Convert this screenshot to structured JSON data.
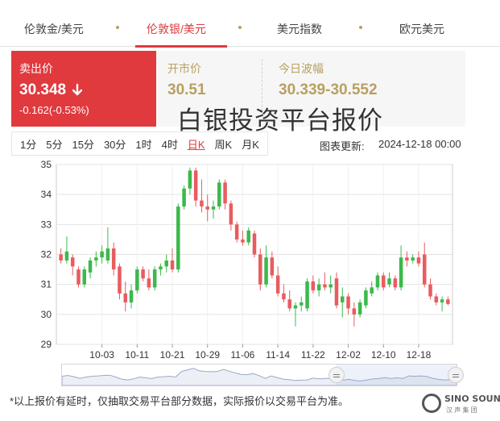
{
  "tabs": [
    {
      "label": "伦敦金/美元",
      "active": false
    },
    {
      "label": "伦敦银/美元",
      "active": true
    },
    {
      "label": "美元指数",
      "active": false
    },
    {
      "label": "欧元美元",
      "active": false
    }
  ],
  "quote": {
    "sell_label": "卖出价",
    "sell_price": "30.348",
    "sell_change": "-0.162(-0.53%)",
    "open_label": "开市价",
    "open_value": "30.51",
    "range_label": "今日波幅",
    "range_value": "30.339-30.552",
    "arrow_icon": "down-arrow-icon"
  },
  "overlay_title": "白银投资平台报价",
  "periods": [
    {
      "label": "1分",
      "active": false
    },
    {
      "label": "5分",
      "active": false
    },
    {
      "label": "15分",
      "active": false
    },
    {
      "label": "30分",
      "active": false
    },
    {
      "label": "1时",
      "active": false
    },
    {
      "label": "4时",
      "active": false
    },
    {
      "label": "日K",
      "active": true
    },
    {
      "label": "周K",
      "active": false
    },
    {
      "label": "月K",
      "active": false
    }
  ],
  "update": {
    "label": "图表更新:",
    "time": "2024-12-18 00:00"
  },
  "colors": {
    "up": "#3cb94b",
    "down": "#e85c60",
    "accent": "#e03a3e",
    "gold": "#b8a060"
  },
  "chart_data": {
    "type": "candlestick",
    "ylim": [
      29,
      35
    ],
    "y_ticks": [
      29,
      30,
      31,
      32,
      33,
      34,
      35
    ],
    "x_tick_labels": [
      "10-03",
      "10-11",
      "10-21",
      "10-29",
      "11-06",
      "11-14",
      "11-22",
      "12-02",
      "12-10",
      "12-18"
    ],
    "x_tick_index": [
      7,
      13,
      19,
      25,
      31,
      37,
      43,
      49,
      55,
      61
    ],
    "candles": [
      [
        32.0,
        32.2,
        31.7,
        31.8
      ],
      [
        31.8,
        32.6,
        31.7,
        32.1
      ],
      [
        31.9,
        32.0,
        31.3,
        31.6
      ],
      [
        31.5,
        31.6,
        30.9,
        31.0
      ],
      [
        31.0,
        31.6,
        30.9,
        31.5
      ],
      [
        31.4,
        31.9,
        31.2,
        31.8
      ],
      [
        31.8,
        32.1,
        31.6,
        31.9
      ],
      [
        31.9,
        32.3,
        31.7,
        32.1
      ],
      [
        31.8,
        32.9,
        31.7,
        32.2
      ],
      [
        32.2,
        32.4,
        31.3,
        31.5
      ],
      [
        31.6,
        31.7,
        30.5,
        30.7
      ],
      [
        30.7,
        31.1,
        30.1,
        30.4
      ],
      [
        30.4,
        31.0,
        30.2,
        30.8
      ],
      [
        30.8,
        31.6,
        30.7,
        31.5
      ],
      [
        31.5,
        31.6,
        31.1,
        31.2
      ],
      [
        31.2,
        31.5,
        30.8,
        30.9
      ],
      [
        30.9,
        31.6,
        30.8,
        31.5
      ],
      [
        31.5,
        31.7,
        31.3,
        31.6
      ],
      [
        31.6,
        32.0,
        31.4,
        31.8
      ],
      [
        31.8,
        32.2,
        31.4,
        31.5
      ],
      [
        31.5,
        33.7,
        31.4,
        33.6
      ],
      [
        33.6,
        34.3,
        33.5,
        34.2
      ],
      [
        34.2,
        34.9,
        34.0,
        34.8
      ],
      [
        34.8,
        34.9,
        33.6,
        33.8
      ],
      [
        33.8,
        34.5,
        33.4,
        33.6
      ],
      [
        33.6,
        34.0,
        33.1,
        33.5
      ],
      [
        33.5,
        33.8,
        33.2,
        33.6
      ],
      [
        33.6,
        34.5,
        33.5,
        34.4
      ],
      [
        34.4,
        34.5,
        33.5,
        33.7
      ],
      [
        33.7,
        33.8,
        32.8,
        33.0
      ],
      [
        33.0,
        33.1,
        32.4,
        32.5
      ],
      [
        32.5,
        32.8,
        32.3,
        32.4
      ],
      [
        32.4,
        32.9,
        32.3,
        32.8
      ],
      [
        32.7,
        32.8,
        31.9,
        32.0
      ],
      [
        32.0,
        32.2,
        30.8,
        31.0
      ],
      [
        31.0,
        32.3,
        30.9,
        31.9
      ],
      [
        31.9,
        32.1,
        31.2,
        31.3
      ],
      [
        31.3,
        31.6,
        30.6,
        30.7
      ],
      [
        30.7,
        31.0,
        30.4,
        30.5
      ],
      [
        30.5,
        30.8,
        30.1,
        30.2
      ],
      [
        30.2,
        30.4,
        29.6,
        30.3
      ],
      [
        30.3,
        30.6,
        30.1,
        30.4
      ],
      [
        30.2,
        31.2,
        30.1,
        31.1
      ],
      [
        31.1,
        31.3,
        30.7,
        30.8
      ],
      [
        30.8,
        31.2,
        30.6,
        31.0
      ],
      [
        31.0,
        31.4,
        30.8,
        30.9
      ],
      [
        30.9,
        31.3,
        30.7,
        31.0
      ],
      [
        31.2,
        31.4,
        30.2,
        30.3
      ],
      [
        30.4,
        30.9,
        29.9,
        30.6
      ],
      [
        30.6,
        30.7,
        30.0,
        30.2
      ],
      [
        30.2,
        30.4,
        29.6,
        30.0
      ],
      [
        30.0,
        30.5,
        29.9,
        30.4
      ],
      [
        30.3,
        30.9,
        30.2,
        30.8
      ],
      [
        30.7,
        31.1,
        30.6,
        30.9
      ],
      [
        30.9,
        31.4,
        30.8,
        31.3
      ],
      [
        31.3,
        31.4,
        30.8,
        30.9
      ],
      [
        31.0,
        31.4,
        30.9,
        31.2
      ],
      [
        31.2,
        31.3,
        30.8,
        30.9
      ],
      [
        30.9,
        32.3,
        30.8,
        31.9
      ],
      [
        31.9,
        32.1,
        31.6,
        31.8
      ],
      [
        31.8,
        32.0,
        31.7,
        31.9
      ],
      [
        31.9,
        32.1,
        31.6,
        31.7
      ],
      [
        32.0,
        32.4,
        30.9,
        31.0
      ],
      [
        31.0,
        31.2,
        30.5,
        30.6
      ],
      [
        30.6,
        30.7,
        30.3,
        30.4
      ],
      [
        30.4,
        30.6,
        30.1,
        30.5
      ],
      [
        30.5,
        30.6,
        30.3,
        30.35
      ]
    ]
  },
  "footnote": "*以上报价有延时，仅抽取交易平台部分数据，实际报价以交易平台为准。",
  "logo": {
    "text": "SINO SOUND",
    "sub": "汉 声 集 团"
  }
}
